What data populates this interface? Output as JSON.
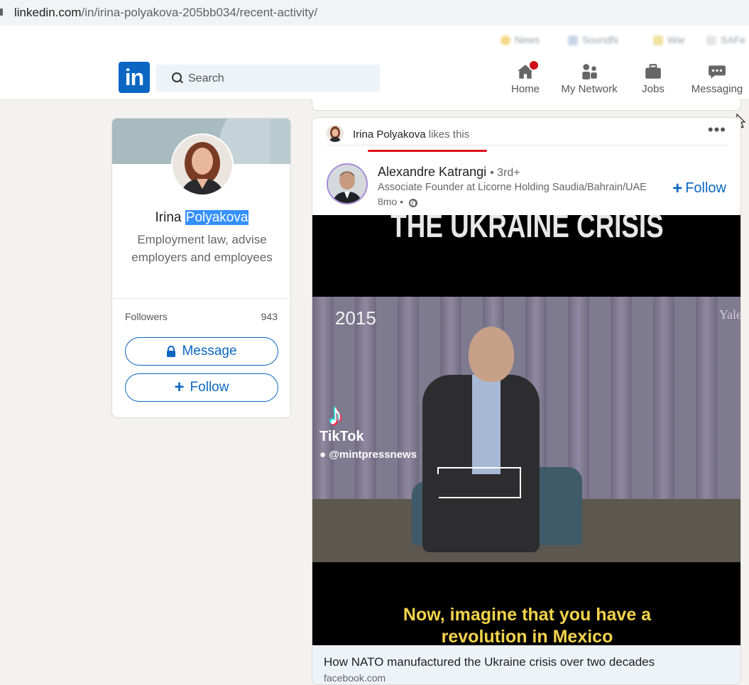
{
  "browser": {
    "url_host": "linkedin.com",
    "url_path": "/in/irina-polyakova-205bb034/recent-activity/"
  },
  "bookmarks": [
    "News",
    "SoundN",
    "War",
    "SAFe"
  ],
  "nav": {
    "logo": "in",
    "search_placeholder": "Search",
    "items": [
      {
        "label": "Home",
        "icon": "home-icon",
        "badge": true
      },
      {
        "label": "My Network",
        "icon": "network-icon"
      },
      {
        "label": "Jobs",
        "icon": "briefcase-icon"
      },
      {
        "label": "Messaging",
        "icon": "messaging-icon"
      }
    ]
  },
  "profile": {
    "first_name": "Irina",
    "last_name": "Polyakova",
    "headline": "Employment law, advise employers and employees",
    "followers_label": "Followers",
    "followers_count": "943",
    "message_label": "Message",
    "follow_label": "Follow"
  },
  "post": {
    "liker_name": "Irina Polyakova",
    "liker_action": "likes this",
    "author_name": "Alexandre Katrangi",
    "author_degree": "• 3rd+",
    "author_title": "Associate Founder at Licorne Holding Saudia/Bahrain/UAE",
    "time": "8mo •",
    "follow_label": "Follow",
    "video": {
      "top_text": "THE UKRAINE CRISIS",
      "year": "2015",
      "watermark": "Yale",
      "tiktok_label": "TikTok",
      "tiktok_handle": "@mintpressnews",
      "subtitle_line1": "Now, imagine that you have a",
      "subtitle_line2": "revolution in Mexico"
    },
    "link_title": "How NATO manufactured the Ukraine crisis over two decades",
    "link_source": "facebook.com"
  },
  "colors": {
    "brand": "#0a66c2",
    "badge": "#cc1016",
    "underline": "#e0101a",
    "selection": "#3390ff"
  }
}
